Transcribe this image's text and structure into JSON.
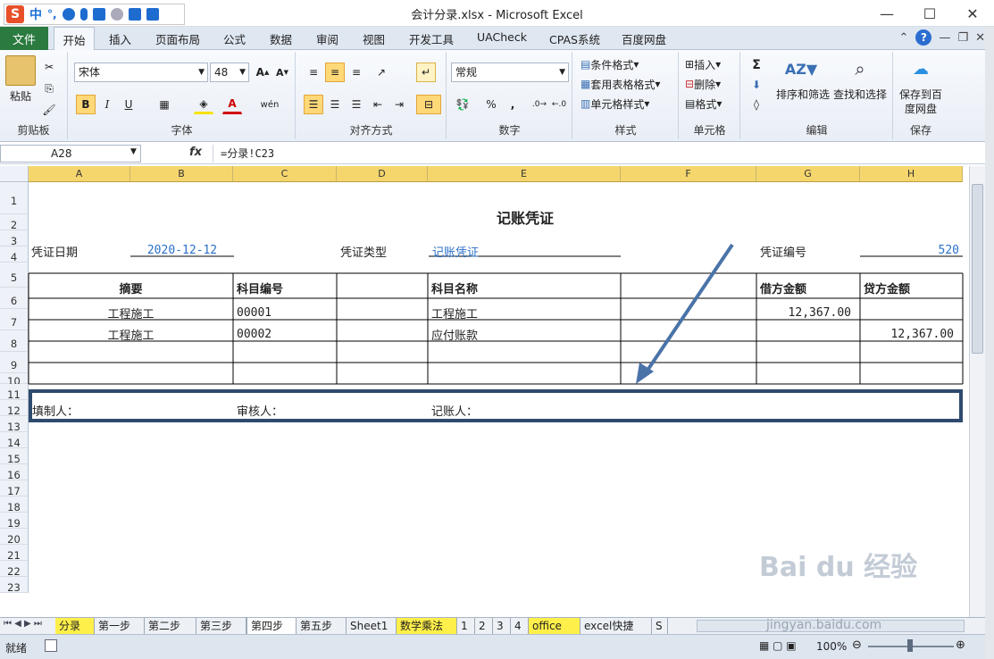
{
  "ime": {
    "logo": "S",
    "mode": "中",
    "punct": "°,"
  },
  "window": {
    "title": "会计分录.xlsx - Microsoft Excel",
    "min": "—",
    "max": "☐",
    "close": "✕"
  },
  "ribbon_tabs": {
    "file": "文件",
    "tabs": [
      "开始",
      "插入",
      "页面布局",
      "公式",
      "数据",
      "审阅",
      "视图",
      "开发工具",
      "UACheck",
      "CPAS系统",
      "百度网盘"
    ]
  },
  "ribbon": {
    "clipboard": {
      "label": "剪贴板",
      "paste": "粘贴"
    },
    "font": {
      "label": "字体",
      "name": "宋体",
      "size": "48",
      "bold": "B",
      "italic": "I",
      "underline": "U"
    },
    "align": {
      "label": "对齐方式"
    },
    "number": {
      "label": "数字",
      "format": "常规"
    },
    "styles": {
      "label": "样式",
      "cond": "条件格式",
      "table": "套用表格格式",
      "cell": "单元格样式"
    },
    "cells": {
      "label": "单元格",
      "insert": "插入",
      "delete": "删除",
      "format": "格式"
    },
    "edit": {
      "label": "编辑",
      "sort": "排序和筛选",
      "find": "查找和选择"
    },
    "save": {
      "label": "保存",
      "btn_l1": "保存到百",
      "btn_l2": "度网盘"
    }
  },
  "formula_bar": {
    "cell": "A28",
    "fx": "fx",
    "formula": "=分录!C23"
  },
  "columns": [
    "A",
    "B",
    "C",
    "D",
    "E",
    "F",
    "G",
    "H"
  ],
  "rows": [
    "1",
    "2",
    "3",
    "4",
    "5",
    "6",
    "7",
    "8",
    "9",
    "10",
    "11",
    "12",
    "13",
    "14",
    "15",
    "16",
    "17",
    "18",
    "19",
    "20",
    "21",
    "22",
    "23"
  ],
  "voucher": {
    "title": "记账凭证",
    "date_label": "凭证日期",
    "date_value": "2020-12-12",
    "type_label": "凭证类型",
    "type_value": "记账凭证",
    "no_label": "凭证编号",
    "no_value": "520",
    "headers": {
      "summary": "摘要",
      "code": "科目编号",
      "name": "科目名称",
      "debit": "借方金额",
      "credit": "贷方金额"
    },
    "entries": [
      {
        "summary": "工程施工",
        "code": "00001",
        "name": "工程施工",
        "debit": "12,367.00",
        "credit": ""
      },
      {
        "summary": "工程施工",
        "code": "00002",
        "name": "应付账款",
        "debit": "",
        "credit": "12,367.00"
      }
    ],
    "signers": {
      "maker": "填制人：",
      "reviewer": "审核人：",
      "bookkeeper": "记账人："
    }
  },
  "sheets": [
    "分录",
    "第一步",
    "第二步",
    "第三步",
    "第四步",
    "第五步",
    "Sheet1",
    "数学乘法",
    "1",
    "2",
    "3",
    "4",
    "office",
    "excel快捷",
    "S"
  ],
  "status": {
    "ready": "就绪",
    "zoom": "100%"
  },
  "watermark": {
    "brand": "Bai du 经验",
    "url": "jingyan.baidu.com"
  },
  "colors": {
    "accent_blue": "#2a70c8",
    "arrow": "#4a73a8",
    "file_tab": "#2b7a3f",
    "header_yellow": "#f5d66d",
    "sheet_yellow": "#ffef4a"
  }
}
